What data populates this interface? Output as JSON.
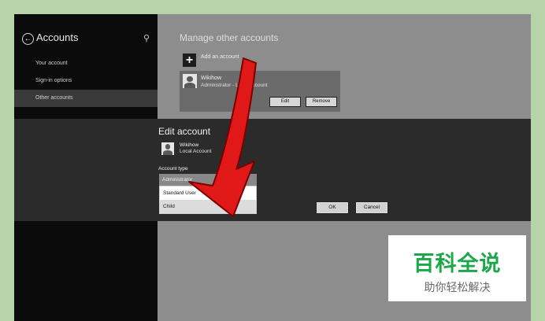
{
  "sidebar": {
    "title": "Accounts",
    "items": [
      {
        "label": "Your account"
      },
      {
        "label": "Sign-in options"
      },
      {
        "label": "Other accounts"
      }
    ]
  },
  "main": {
    "title": "Manage other accounts",
    "add_account_label": "Add an account",
    "account": {
      "name": "Wikihow",
      "role": "Administrator - Local Account"
    },
    "edit_label": "Edit",
    "remove_label": "Remove"
  },
  "dialog": {
    "title": "Edit account",
    "account_name": "Wikihow",
    "account_kind": "Local Account",
    "account_type_label": "Account type",
    "selected_type": "Administrator",
    "options": [
      "Standard User",
      "Child"
    ],
    "ok_label": "OK",
    "cancel_label": "Cancel"
  },
  "annotation": {
    "arrow_color": "#e01818"
  },
  "watermark": {
    "title": "百科全说",
    "subtitle": "助你轻松解决",
    "color": "#1aa84a"
  }
}
